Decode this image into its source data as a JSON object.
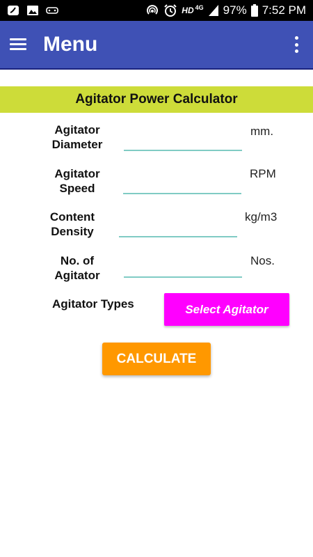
{
  "status_bar": {
    "icons_left": [
      "saavn-icon",
      "gallery-icon",
      "game-controller-icon"
    ],
    "hd": "HD",
    "network": "4G",
    "battery": "97%",
    "time": "7:52 PM"
  },
  "app_bar": {
    "title": "Menu"
  },
  "calculator": {
    "heading": "Agitator Power Calculator",
    "fields": [
      {
        "label_line1": "Agitator",
        "label_line2": "Diameter",
        "value": "",
        "unit": "mm."
      },
      {
        "label_line1": "Agitator",
        "label_line2": "Speed",
        "value": "",
        "unit": "RPM"
      },
      {
        "label_line1": "Content",
        "label_line2": "Density",
        "value": "",
        "unit": "kg/m3"
      },
      {
        "label_line1": "No. of",
        "label_line2": "Agitator",
        "value": "",
        "unit": "Nos."
      }
    ],
    "types_label": "Agitator Types",
    "select_label": "Select Agitator",
    "calculate_label": "CALCULATE"
  },
  "colors": {
    "app_bar": "#3f51b5",
    "header_band": "#cddc39",
    "select_button": "#ff00ff",
    "calculate_button": "#ff9800",
    "field_underline": "#80cbc4"
  }
}
